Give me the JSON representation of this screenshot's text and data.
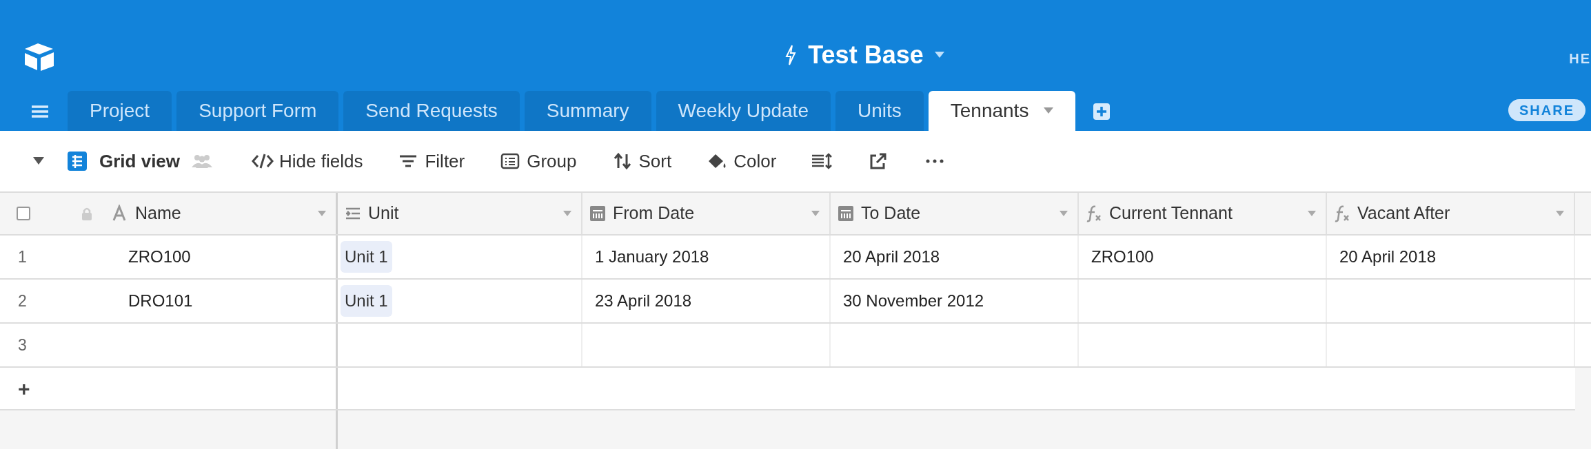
{
  "header": {
    "title": "Test Base",
    "right_text": "HE"
  },
  "tabs": [
    {
      "label": "Project",
      "selected": false
    },
    {
      "label": "Support Form",
      "selected": false
    },
    {
      "label": "Send Requests",
      "selected": false
    },
    {
      "label": "Summary",
      "selected": false
    },
    {
      "label": "Weekly Update",
      "selected": false
    },
    {
      "label": "Units",
      "selected": false
    },
    {
      "label": "Tennants",
      "selected": true
    }
  ],
  "share_button": "SHARE",
  "view": {
    "name": "Grid view"
  },
  "toolbar": [
    {
      "kind": "hide",
      "label": "Hide fields"
    },
    {
      "kind": "filter",
      "label": "Filter"
    },
    {
      "kind": "group",
      "label": "Group"
    },
    {
      "kind": "sort",
      "label": "Sort"
    },
    {
      "kind": "color",
      "label": "Color"
    },
    {
      "kind": "height"
    },
    {
      "kind": "share"
    },
    {
      "kind": "more"
    }
  ],
  "table": {
    "select_all": {
      "checked": false
    },
    "columns": [
      {
        "label": "Name",
        "kind": "text"
      },
      {
        "label": "Unit",
        "kind": "link"
      },
      {
        "label": "From Date",
        "kind": "date"
      },
      {
        "label": "To Date",
        "kind": "date"
      },
      {
        "label": "Current Tennant",
        "kind": "formula"
      },
      {
        "label": "Vacant After",
        "kind": "formula"
      }
    ],
    "rows": [
      {
        "number": "1",
        "cells": [
          "ZRO100",
          "Unit 1",
          "1 January 2018",
          "20 April 2018",
          "ZRO100",
          "20 April 2018"
        ]
      },
      {
        "number": "2",
        "cells": [
          "DRO101",
          "Unit 1",
          "23 April 2018",
          "30 November 2012",
          null,
          null
        ]
      },
      {
        "number": "3",
        "cells": [
          null,
          null,
          null,
          null,
          null,
          null
        ]
      }
    ],
    "add_row": "+"
  }
}
